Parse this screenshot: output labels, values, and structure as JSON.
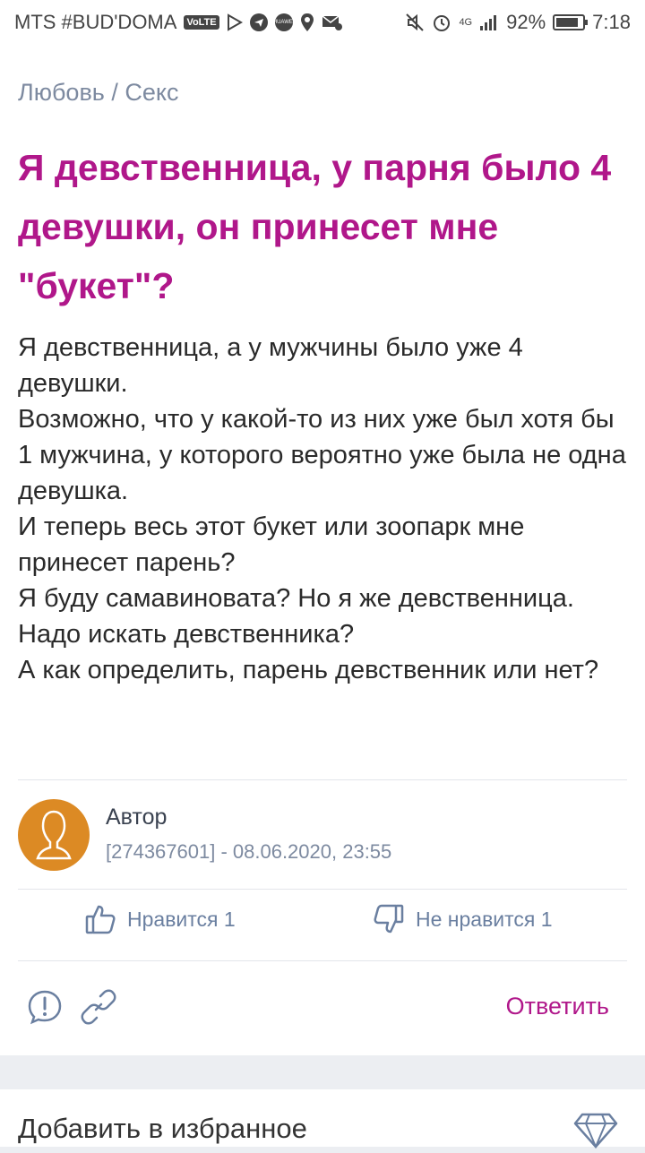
{
  "status_bar": {
    "carrier": "MTS #BUD'DOMA",
    "volte_badge": "VoLTE",
    "huawei_badge": "HUAWEI",
    "network_type": "4G",
    "battery": "92%",
    "battery_level": 0.92,
    "time": "7:18"
  },
  "breadcrumb": "Любовь / Секс",
  "question": {
    "title": "Я девственница, у парня было 4 девушки, он принесет мне \"букет\"?",
    "body": "Я девственница, а у мужчины было уже 4 девушки.\nВозможно, что у какой-то из них уже был хотя бы 1 мужчина, у которого вероятно уже была не одна девушка.\nИ теперь весь этот букет или зоопарк мне принесет парень?\nЯ буду самавиновата? Но я же девственница.\nНадо искать девственника?\nА как определить, парень девственник или нет?"
  },
  "author": {
    "name": "Автор",
    "meta": "[274367601] - 08.06.2020, 23:55"
  },
  "votes": {
    "like_label": "Нравится 1",
    "dislike_label": "Не нравится 1"
  },
  "actions": {
    "reply_label": "Ответить"
  },
  "favorites": {
    "label": "Добавить в избранное"
  },
  "colors": {
    "accent": "#b0178a",
    "muted": "#7d8aa0",
    "vote": "#6a7fa0",
    "avatar": "#dc8a24"
  },
  "icons": [
    "thumbs-up-icon",
    "thumbs-down-icon",
    "report-icon",
    "link-icon",
    "diamond-icon"
  ]
}
